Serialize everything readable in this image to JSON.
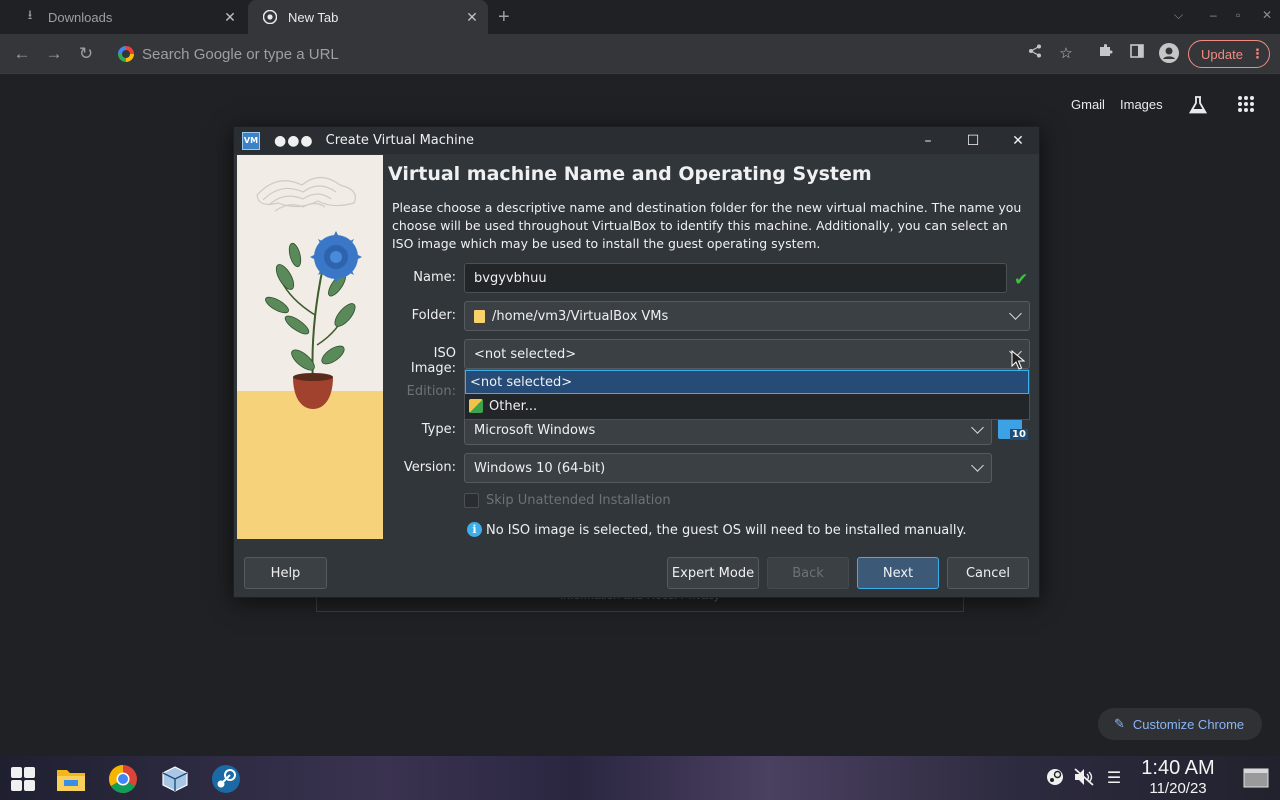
{
  "browser": {
    "tabs": [
      {
        "label": "Downloads",
        "icon": "download-icon"
      },
      {
        "label": "New Tab",
        "icon": "chrome-icon"
      }
    ],
    "omnibox_placeholder": "Search Google or type a URL",
    "update_label": "Update"
  },
  "ntp": {
    "gmail": "Gmail",
    "images": "Images",
    "customize": "Customize Chrome",
    "behind_text": "Information and Recs. Privacy"
  },
  "dialog": {
    "title": "Create Virtual Machine",
    "heading": "Virtual machine Name and Operating System",
    "description": "Please choose a descriptive name and destination folder for the new virtual machine. The name you choose will be used throughout VirtualBox to identify this machine. Additionally, you can select an ISO image which may be used to install the guest operating system.",
    "labels": {
      "name": "Name:",
      "folder": "Folder:",
      "iso": "ISO Image:",
      "edition": "Edition:",
      "type": "Type:",
      "version": "Version:"
    },
    "values": {
      "name": "bvgyvbhuu",
      "folder": "/home/vm3/VirtualBox VMs",
      "iso": "<not selected>",
      "type": "Microsoft Windows",
      "version": "Windows 10 (64-bit)"
    },
    "iso_options": [
      "<not selected>",
      "Other..."
    ],
    "os_badge": "10",
    "skip_unattended": "Skip Unattended Installation",
    "info": "No ISO image is selected, the guest OS will need to be installed manually.",
    "buttons": {
      "help": "Help",
      "expert": "Expert Mode",
      "back": "Back",
      "next": "Next",
      "cancel": "Cancel"
    }
  },
  "taskbar": {
    "time": "1:40 AM",
    "date": "11/20/23"
  },
  "colors": {
    "dialog_bg": "#31363b",
    "selection": "#264b76",
    "accent": "#3daee9",
    "update": "#f28b82"
  }
}
